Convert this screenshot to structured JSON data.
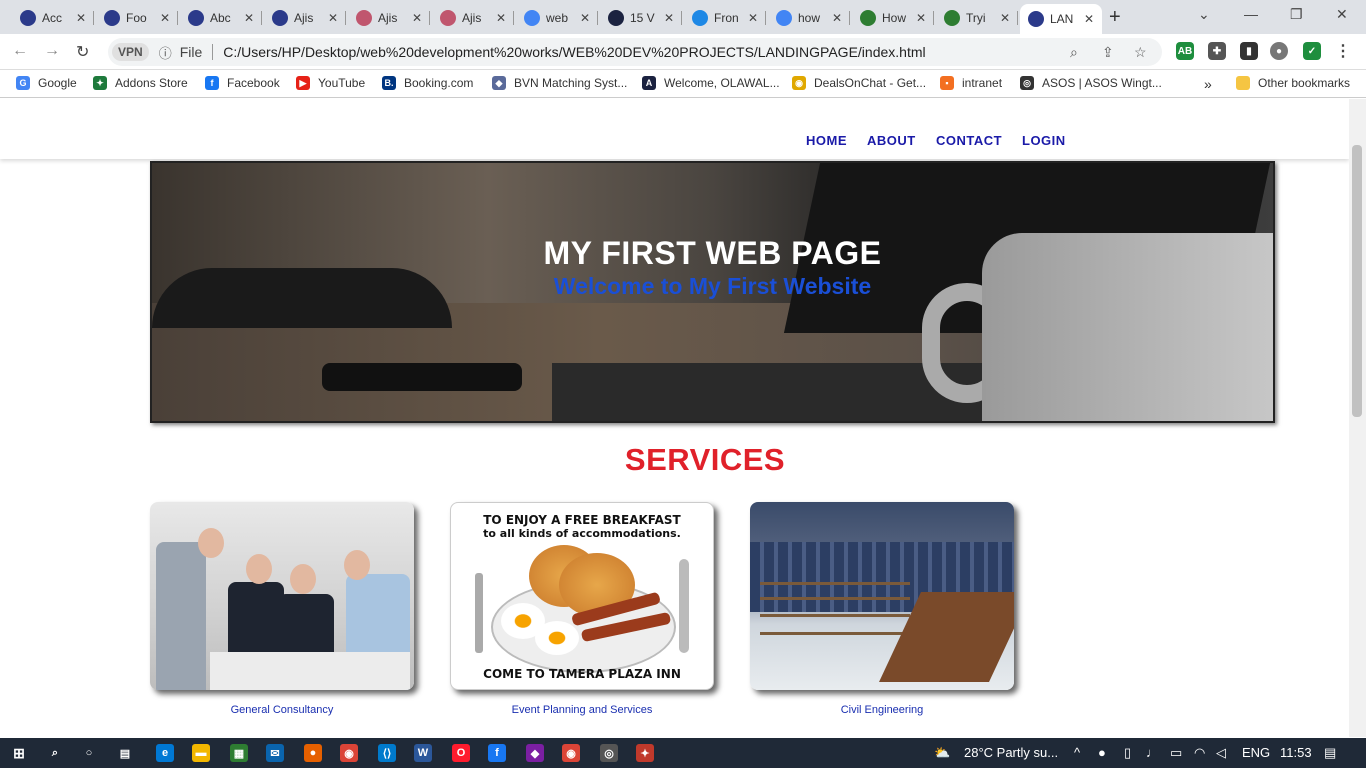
{
  "browser": {
    "tabs": [
      {
        "title": "Acc",
        "favicon": "globe-icon",
        "color": "#2b3a8a"
      },
      {
        "title": "Foo",
        "favicon": "globe-icon",
        "color": "#2b3a8a"
      },
      {
        "title": "Abc",
        "favicon": "globe-icon",
        "color": "#2b3a8a"
      },
      {
        "title": "Ajis",
        "favicon": "globe-icon",
        "color": "#2b3a8a"
      },
      {
        "title": "Ajis",
        "favicon": "user-icon",
        "color": "#c0566e"
      },
      {
        "title": "Ajis",
        "favicon": "user-icon",
        "color": "#c0566e"
      },
      {
        "title": "web",
        "favicon": "google-icon",
        "color": "#4285f4"
      },
      {
        "title": "15 V",
        "favicon": "app-icon",
        "color": "#1b2240"
      },
      {
        "title": "Fron",
        "favicon": "app-icon",
        "color": "#1e88e5"
      },
      {
        "title": "how",
        "favicon": "google-icon",
        "color": "#4285f4"
      },
      {
        "title": "How",
        "favicon": "wikihow-icon",
        "color": "#2e7d32"
      },
      {
        "title": "Tryi",
        "favicon": "wikihow-icon",
        "color": "#2e7d32"
      },
      {
        "title": "LAN",
        "favicon": "globe-icon",
        "color": "#2b3a8a"
      }
    ],
    "new_tab": "+",
    "address": {
      "vpn": "VPN",
      "scheme": "File",
      "url": "C:/Users/HP/Desktop/web%20development%20works/WEB%20DEV%20PROJECTS/LANDINGPAGE/index.html"
    },
    "bookmarks": [
      {
        "label": "Google",
        "color": "#4285f4",
        "glyph": "G"
      },
      {
        "label": "Addons Store",
        "color": "#1e7a3c",
        "glyph": "✦"
      },
      {
        "label": "Facebook",
        "color": "#1877f2",
        "glyph": "f"
      },
      {
        "label": "YouTube",
        "color": "#e62117",
        "glyph": "▶"
      },
      {
        "label": "Booking.com",
        "color": "#003580",
        "glyph": "B."
      },
      {
        "label": "BVN Matching Syst...",
        "color": "#5a6a9a",
        "glyph": "◆"
      },
      {
        "label": "Welcome, OLAWAL...",
        "color": "#1b2240",
        "glyph": "A"
      },
      {
        "label": "DealsOnChat - Get...",
        "color": "#e0a800",
        "glyph": "◉"
      },
      {
        "label": "intranet",
        "color": "#f36f21",
        "glyph": "▪"
      },
      {
        "label": "ASOS | ASOS Wingt...",
        "color": "#333333",
        "glyph": "◎"
      }
    ],
    "bookmarks_more": "»",
    "other_bookmarks": "Other bookmarks"
  },
  "page": {
    "nav": [
      "HOME",
      "ABOUT",
      "CONTACT",
      "LOGIN"
    ],
    "hero": {
      "title": "MY FIRST WEB PAGE",
      "subtitle": "Welcome to My First Website"
    },
    "services_title": "SERVICES",
    "services": [
      {
        "caption": "General Consultancy"
      },
      {
        "caption": "Event Planning and Services",
        "flyer_top": "TO ENJOY A FREE BREAKFAST",
        "flyer_sub": "to all kinds of accommodations.",
        "flyer_bottom": "COME TO TAMERA PLAZA INN"
      },
      {
        "caption": "Civil Engineering"
      }
    ],
    "colors": {
      "nav": "#1a1aa8",
      "services_title": "#e0212a",
      "hero_subtitle": "#1a4fd6",
      "caption": "#1a2fb0"
    }
  },
  "taskbar": {
    "weather": "28°C  Partly su...",
    "language": "ENG",
    "time": "11:53"
  }
}
